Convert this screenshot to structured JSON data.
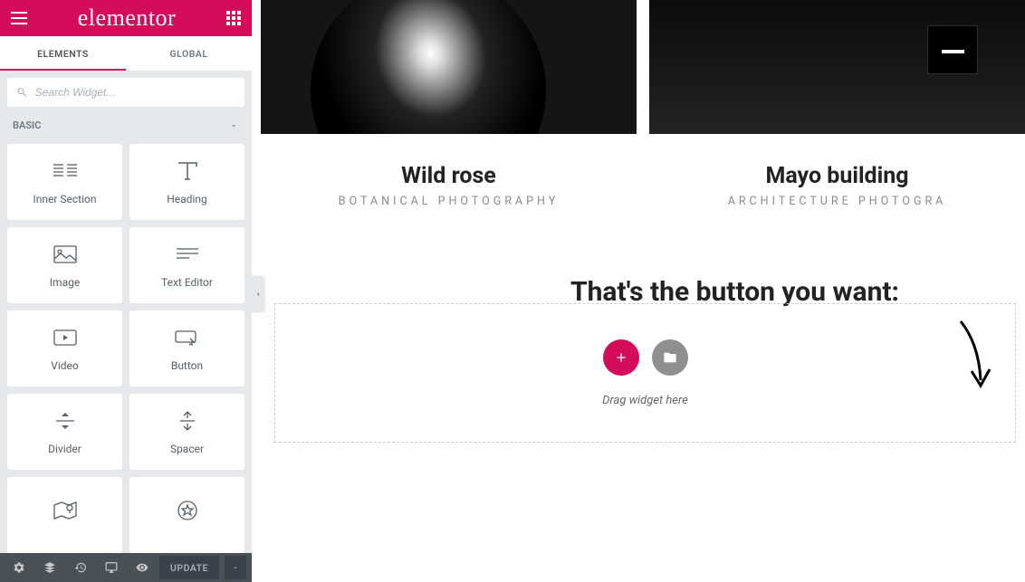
{
  "brand": {
    "logo_text": "elementor"
  },
  "tabs": {
    "elements_label": "ELEMENTS",
    "global_label": "GLOBAL"
  },
  "search": {
    "placeholder": "Search Widget..."
  },
  "category": {
    "basic_label": "BASIC"
  },
  "widgets": {
    "inner_section": "Inner Section",
    "heading": "Heading",
    "image": "Image",
    "text_editor": "Text Editor",
    "video": "Video",
    "button": "Button",
    "divider": "Divider",
    "spacer": "Spacer"
  },
  "footer": {
    "update_label": "UPDATE"
  },
  "portfolio": {
    "item1": {
      "title": "Wild rose",
      "subtitle": "BOTANICAL PHOTOGRAPHY"
    },
    "item2": {
      "title": "Mayo building",
      "subtitle": "ARCHITECTURE PHOTOGRA"
    }
  },
  "annotation_text": "That's the button you want:",
  "section": {
    "drag_hint": "Drag widget here"
  }
}
